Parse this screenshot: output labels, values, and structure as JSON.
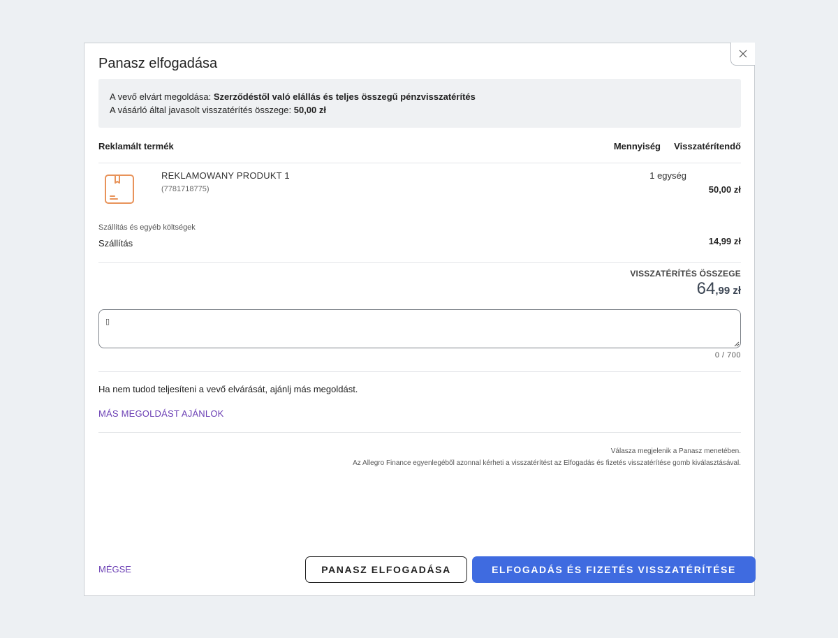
{
  "dialog": {
    "title": "Panasz elfogadása",
    "close_icon": "close-icon"
  },
  "info": {
    "expected_label": "A vevő elvárt megoldása: ",
    "expected_value": "Szerződéstől való elállás és teljes összegű pénzvisszatérítés",
    "suggested_label": "A vásárló által javasolt visszatérítés összege: ",
    "suggested_value": "50,00 zł"
  },
  "table": {
    "header_product": "Reklamált termék",
    "header_quantity": "Mennyiség",
    "header_refund": "Visszatérítendő"
  },
  "product": {
    "icon": "package-box-icon",
    "name": "REKLAMOWANY PRODUKT 1",
    "code": "(7781718775)",
    "quantity": "1 egység",
    "amount": "50,00 zł"
  },
  "shipping": {
    "section_label": "Szállítás és egyéb költségek",
    "label": "Szállítás",
    "amount": "14,99 zł"
  },
  "total": {
    "label": "VISSZATÉRÍTÉS ÖSSZEGE",
    "integer": "64",
    "decimal": ",99 zł"
  },
  "comment": {
    "value": "▯",
    "counter": "0 / 700"
  },
  "alternative": {
    "text": "Ha nem tudod teljesíteni a vevő elvárását, ajánlj más megoldást.",
    "link": "MÁS MEGOLDÁST AJÁNLOK"
  },
  "note": {
    "line1": "Válasza megjelenik a Panasz menetében.",
    "line2": "Az Allegro Finance egyenlegéből azonnal kérheti a visszatérítést az Elfogadás és fizetés visszatérítése gomb kiválasztásával."
  },
  "footer": {
    "cancel": "MÉGSE",
    "accept": "PANASZ ELFOGADÁSA",
    "accept_and_pay": "ELFOGADÁS ÉS FIZETÉS VISSZATÉRÍTÉSE"
  },
  "colors": {
    "accent": "#3f6be0",
    "link": "#6b3fb4",
    "product_icon": "#e8935a"
  }
}
